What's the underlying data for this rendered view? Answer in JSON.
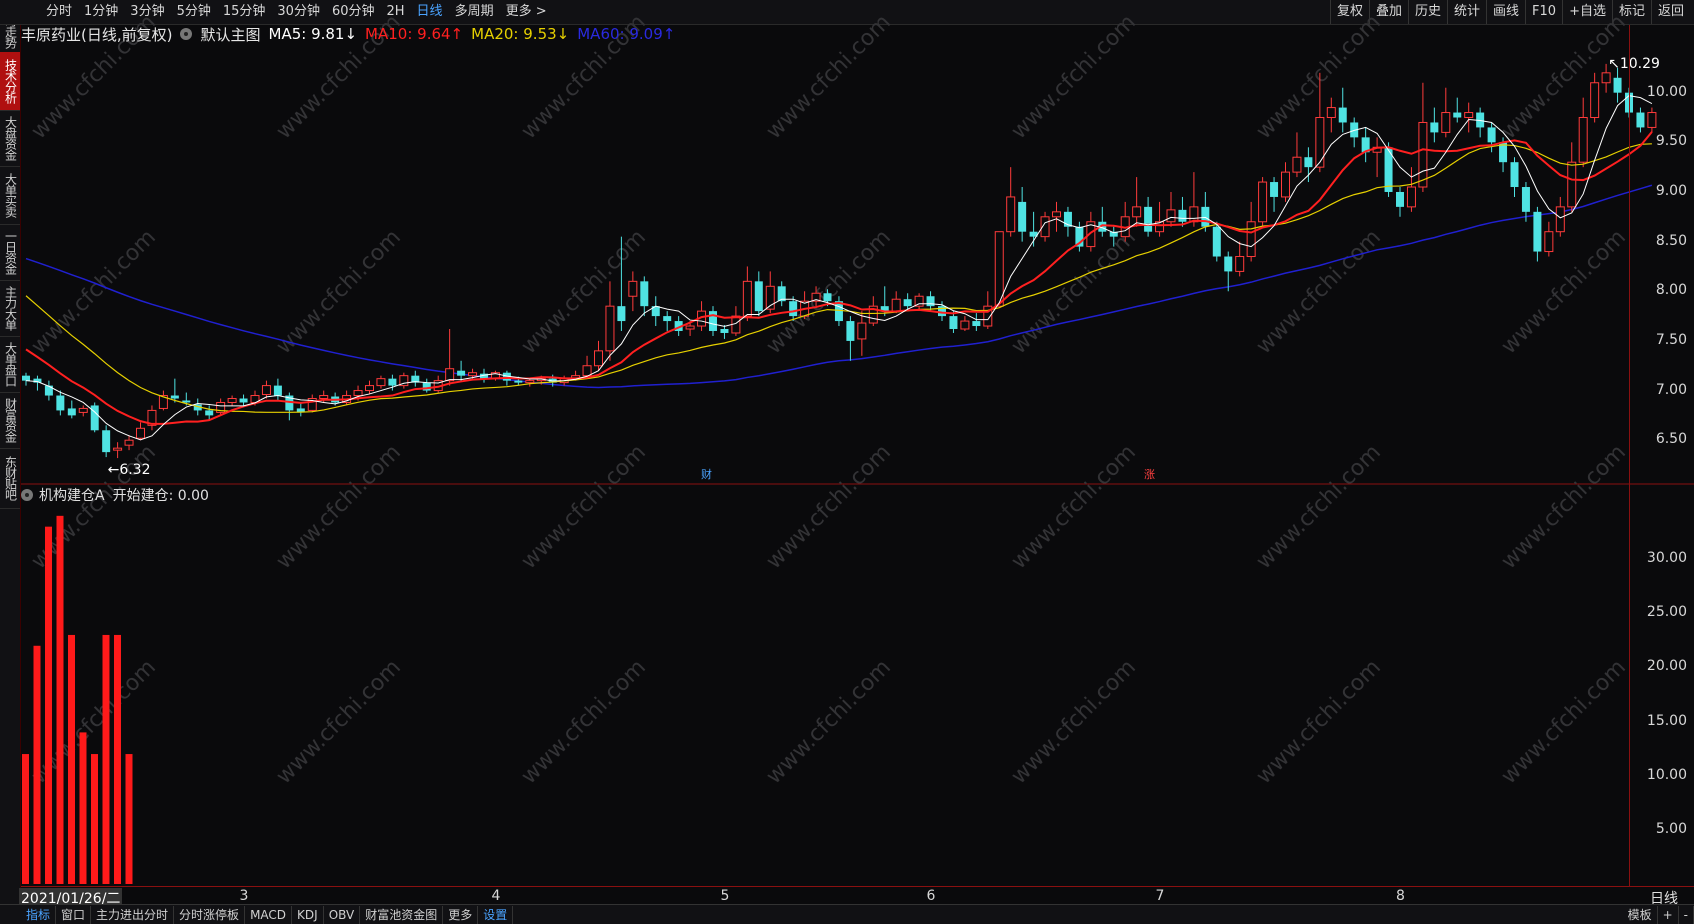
{
  "top_tabs": [
    "分时",
    "1分钟",
    "3分钟",
    "5分钟",
    "15分钟",
    "30分钟",
    "60分钟",
    "2H",
    "日线",
    "多周期",
    "更多 >"
  ],
  "active_tab": "日线",
  "top_right_tabs": [
    "复权",
    "叠加",
    "历史",
    "统计",
    "画线",
    "F10",
    "+自选",
    "标记",
    "返回"
  ],
  "sidebar": [
    "分时走势",
    "技术分析",
    "大盘资金",
    "大单买卖",
    "一日资金",
    "主力大单",
    "大单盘口",
    "财富资金",
    "东财贴吧"
  ],
  "chart": {
    "stock_title": "丰原药业(日线,前复权)",
    "template": "默认主图",
    "ma5": "MA5: 9.81↓",
    "ma10": "MA10: 9.64↑",
    "ma20": "MA20: 9.53↓",
    "ma60": "MA60: 9.09↑",
    "high_label": "10.29",
    "low_label": "6.32",
    "marker_cai": "财",
    "marker_zhang": "涨"
  },
  "indicator": {
    "title": "机构建仓A",
    "value": "开始建仓: 0.00"
  },
  "price_axis": [
    "10.00",
    "9.50",
    "9.00",
    "8.50",
    "8.00",
    "7.50",
    "7.00",
    "6.50"
  ],
  "indicator_axis": [
    "30.00",
    "25.00",
    "20.00",
    "15.00",
    "10.00",
    "5.00"
  ],
  "x_axis": {
    "start_date": "2021/01/26/二",
    "months": [
      "3",
      "4",
      "5",
      "6",
      "7",
      "8"
    ]
  },
  "period_label": "日线",
  "bottom_tabs": [
    "指标",
    "窗口",
    "主力进出分时",
    "分时涨停板",
    "MACD",
    "KDJ",
    "OBV",
    "财富池资金图",
    "更多",
    "设置"
  ],
  "bottom_right": [
    "模板",
    "+",
    "-"
  ],
  "watermark": "www.cfchi.com",
  "colors": {
    "up": "#ff3b3b",
    "down": "#4fe3e3",
    "ma5": "#ffffff",
    "ma10": "#ff2020",
    "ma20": "#e6d000",
    "ma60": "#2020d0"
  },
  "chart_data": {
    "type": "candlestick",
    "candles": [
      [
        7.15,
        7.1,
        7.18,
        7.05
      ],
      [
        7.12,
        7.08,
        7.15,
        7.0
      ],
      [
        7.05,
        6.95,
        7.1,
        6.9
      ],
      [
        6.95,
        6.8,
        7.0,
        6.75
      ],
      [
        6.82,
        6.75,
        6.9,
        6.72
      ],
      [
        6.78,
        6.82,
        6.85,
        6.74
      ],
      [
        6.85,
        6.6,
        6.88,
        6.58
      ],
      [
        6.6,
        6.38,
        6.65,
        6.33
      ],
      [
        6.4,
        6.42,
        6.48,
        6.32
      ],
      [
        6.45,
        6.5,
        6.55,
        6.4
      ],
      [
        6.52,
        6.62,
        6.68,
        6.5
      ],
      [
        6.65,
        6.8,
        6.85,
        6.6
      ],
      [
        6.82,
        6.95,
        7.0,
        6.8
      ],
      [
        6.95,
        6.92,
        7.12,
        6.88
      ],
      [
        6.9,
        6.88,
        6.98,
        6.85
      ],
      [
        6.86,
        6.8,
        6.92,
        6.75
      ],
      [
        6.8,
        6.75,
        6.85,
        6.7
      ],
      [
        6.78,
        6.88,
        6.92,
        6.75
      ],
      [
        6.88,
        6.92,
        6.95,
        6.85
      ],
      [
        6.92,
        6.88,
        6.96,
        6.84
      ],
      [
        6.88,
        6.95,
        7.0,
        6.85
      ],
      [
        6.96,
        7.05,
        7.1,
        6.92
      ],
      [
        7.05,
        6.95,
        7.12,
        6.9
      ],
      [
        6.95,
        6.8,
        6.98,
        6.7
      ],
      [
        6.82,
        6.78,
        6.88,
        6.74
      ],
      [
        6.8,
        6.92,
        6.96,
        6.78
      ],
      [
        6.92,
        6.95,
        7.0,
        6.88
      ],
      [
        6.94,
        6.88,
        6.98,
        6.85
      ],
      [
        6.88,
        6.95,
        7.0,
        6.86
      ],
      [
        6.95,
        7.0,
        7.05,
        6.9
      ],
      [
        7.0,
        7.05,
        7.1,
        6.96
      ],
      [
        7.05,
        7.12,
        7.15,
        7.02
      ],
      [
        7.12,
        7.05,
        7.16,
        7.0
      ],
      [
        7.05,
        7.15,
        7.18,
        7.02
      ],
      [
        7.15,
        7.08,
        7.2,
        7.04
      ],
      [
        7.08,
        7.0,
        7.12,
        6.98
      ],
      [
        7.0,
        7.1,
        7.15,
        6.98
      ],
      [
        7.1,
        7.22,
        7.62,
        7.05
      ],
      [
        7.2,
        7.15,
        7.3,
        7.1
      ],
      [
        7.15,
        7.18,
        7.22,
        7.12
      ],
      [
        7.17,
        7.12,
        7.22,
        7.08
      ],
      [
        7.12,
        7.18,
        7.2,
        7.1
      ],
      [
        7.18,
        7.1,
        7.2,
        7.05
      ],
      [
        7.1,
        7.08,
        7.14,
        7.05
      ],
      [
        7.08,
        7.1,
        7.12,
        7.04
      ],
      [
        7.1,
        7.12,
        7.15,
        7.06
      ],
      [
        7.12,
        7.08,
        7.16,
        7.04
      ],
      [
        7.08,
        7.12,
        7.15,
        7.05
      ],
      [
        7.12,
        7.15,
        7.2,
        7.1
      ],
      [
        7.15,
        7.25,
        7.35,
        7.12
      ],
      [
        7.25,
        7.4,
        7.5,
        7.2
      ],
      [
        7.4,
        7.85,
        8.1,
        7.3
      ],
      [
        7.85,
        7.7,
        8.55,
        7.6
      ],
      [
        7.95,
        8.1,
        8.2,
        7.8
      ],
      [
        8.1,
        7.85,
        8.15,
        7.75
      ],
      [
        7.85,
        7.75,
        7.95,
        7.65
      ],
      [
        7.75,
        7.7,
        7.8,
        7.6
      ],
      [
        7.7,
        7.6,
        7.75,
        7.55
      ],
      [
        7.62,
        7.65,
        7.7,
        7.55
      ],
      [
        7.65,
        7.8,
        7.9,
        7.6
      ],
      [
        7.8,
        7.6,
        7.85,
        7.55
      ],
      [
        7.62,
        7.58,
        7.66,
        7.52
      ],
      [
        7.58,
        7.75,
        7.85,
        7.55
      ],
      [
        7.75,
        8.1,
        8.25,
        7.7
      ],
      [
        8.1,
        7.8,
        8.2,
        7.75
      ],
      [
        7.82,
        8.05,
        8.2,
        7.78
      ],
      [
        8.05,
        7.9,
        8.1,
        7.85
      ],
      [
        7.9,
        7.75,
        7.95,
        7.7
      ],
      [
        7.75,
        7.9,
        8.0,
        7.72
      ],
      [
        7.9,
        7.98,
        8.05,
        7.85
      ],
      [
        7.98,
        7.9,
        8.02,
        7.85
      ],
      [
        7.9,
        7.7,
        7.95,
        7.65
      ],
      [
        7.7,
        7.5,
        7.75,
        7.3
      ],
      [
        7.52,
        7.68,
        7.8,
        7.35
      ],
      [
        7.68,
        7.85,
        7.95,
        7.65
      ],
      [
        7.85,
        7.8,
        8.05,
        7.75
      ],
      [
        7.8,
        7.92,
        8.0,
        7.78
      ],
      [
        7.92,
        7.85,
        7.98,
        7.8
      ],
      [
        7.85,
        7.95,
        7.98,
        7.82
      ],
      [
        7.95,
        7.85,
        8.0,
        7.8
      ],
      [
        7.85,
        7.75,
        7.9,
        7.7
      ],
      [
        7.75,
        7.62,
        7.8,
        7.58
      ],
      [
        7.62,
        7.7,
        7.75,
        7.6
      ],
      [
        7.7,
        7.65,
        7.78,
        7.6
      ],
      [
        7.65,
        7.85,
        8.0,
        7.62
      ],
      [
        7.85,
        8.6,
        8.6,
        7.85
      ],
      [
        8.6,
        8.95,
        9.25,
        8.55
      ],
      [
        8.9,
        8.6,
        9.05,
        8.5
      ],
      [
        8.6,
        8.55,
        8.8,
        8.45
      ],
      [
        8.55,
        8.75,
        8.8,
        8.5
      ],
      [
        8.75,
        8.8,
        8.9,
        8.6
      ],
      [
        8.8,
        8.65,
        8.85,
        8.55
      ],
      [
        8.65,
        8.45,
        8.7,
        8.4
      ],
      [
        8.45,
        8.7,
        8.8,
        8.4
      ],
      [
        8.7,
        8.6,
        8.85,
        8.55
      ],
      [
        8.6,
        8.55,
        8.65,
        8.45
      ],
      [
        8.55,
        8.75,
        8.9,
        8.5
      ],
      [
        8.75,
        8.85,
        9.15,
        8.65
      ],
      [
        8.85,
        8.6,
        8.95,
        8.55
      ],
      [
        8.6,
        8.7,
        8.9,
        8.55
      ],
      [
        8.7,
        8.82,
        9.0,
        8.65
      ],
      [
        8.82,
        8.7,
        8.95,
        8.65
      ],
      [
        8.7,
        8.85,
        9.2,
        8.65
      ],
      [
        8.85,
        8.65,
        9.0,
        8.6
      ],
      [
        8.65,
        8.35,
        8.7,
        8.3
      ],
      [
        8.35,
        8.2,
        8.4,
        8.0
      ],
      [
        8.2,
        8.35,
        8.5,
        8.15
      ],
      [
        8.35,
        8.7,
        8.9,
        8.3
      ],
      [
        8.7,
        9.1,
        9.15,
        8.65
      ],
      [
        9.1,
        8.95,
        9.15,
        8.8
      ],
      [
        8.95,
        9.2,
        9.3,
        8.9
      ],
      [
        9.2,
        9.35,
        9.6,
        9.15
      ],
      [
        9.35,
        9.25,
        9.45,
        9.1
      ],
      [
        9.25,
        9.75,
        10.2,
        9.2
      ],
      [
        9.75,
        9.85,
        9.95,
        9.6
      ],
      [
        9.85,
        9.7,
        10.05,
        9.6
      ],
      [
        9.7,
        9.55,
        9.75,
        9.45
      ],
      [
        9.55,
        9.4,
        9.65,
        9.3
      ],
      [
        9.4,
        9.45,
        9.55,
        9.15
      ],
      [
        9.45,
        9.0,
        9.5,
        8.95
      ],
      [
        9.0,
        8.85,
        9.05,
        8.75
      ],
      [
        8.85,
        9.05,
        9.25,
        8.8
      ],
      [
        9.05,
        9.7,
        10.1,
        9.0
      ],
      [
        9.7,
        9.6,
        9.85,
        9.5
      ],
      [
        9.6,
        9.8,
        10.05,
        9.55
      ],
      [
        9.8,
        9.75,
        9.95,
        9.7
      ],
      [
        9.75,
        9.8,
        9.9,
        9.6
      ],
      [
        9.8,
        9.65,
        9.85,
        9.55
      ],
      [
        9.65,
        9.5,
        9.7,
        9.4
      ],
      [
        9.5,
        9.3,
        9.55,
        9.2
      ],
      [
        9.3,
        9.05,
        9.35,
        8.95
      ],
      [
        9.05,
        8.8,
        9.1,
        8.7
      ],
      [
        8.8,
        8.4,
        8.85,
        8.3
      ],
      [
        8.4,
        8.6,
        8.7,
        8.35
      ],
      [
        8.6,
        8.85,
        8.95,
        8.55
      ],
      [
        8.85,
        9.3,
        9.5,
        8.8
      ],
      [
        9.3,
        9.75,
        9.95,
        9.25
      ],
      [
        9.75,
        10.1,
        10.2,
        9.7
      ],
      [
        10.1,
        10.2,
        10.29,
        10.0
      ],
      [
        10.15,
        10.0,
        10.25,
        9.9
      ],
      [
        10.0,
        9.8,
        10.05,
        9.75
      ],
      [
        9.8,
        9.65,
        9.85,
        9.6
      ],
      [
        9.65,
        9.8,
        9.85,
        9.6
      ]
    ],
    "indicator_values": [
      12,
      22,
      33,
      34,
      23,
      14,
      12,
      23,
      23,
      12
    ],
    "y_range": [
      6.2,
      10.45
    ],
    "indicator_range": [
      0,
      35
    ]
  }
}
